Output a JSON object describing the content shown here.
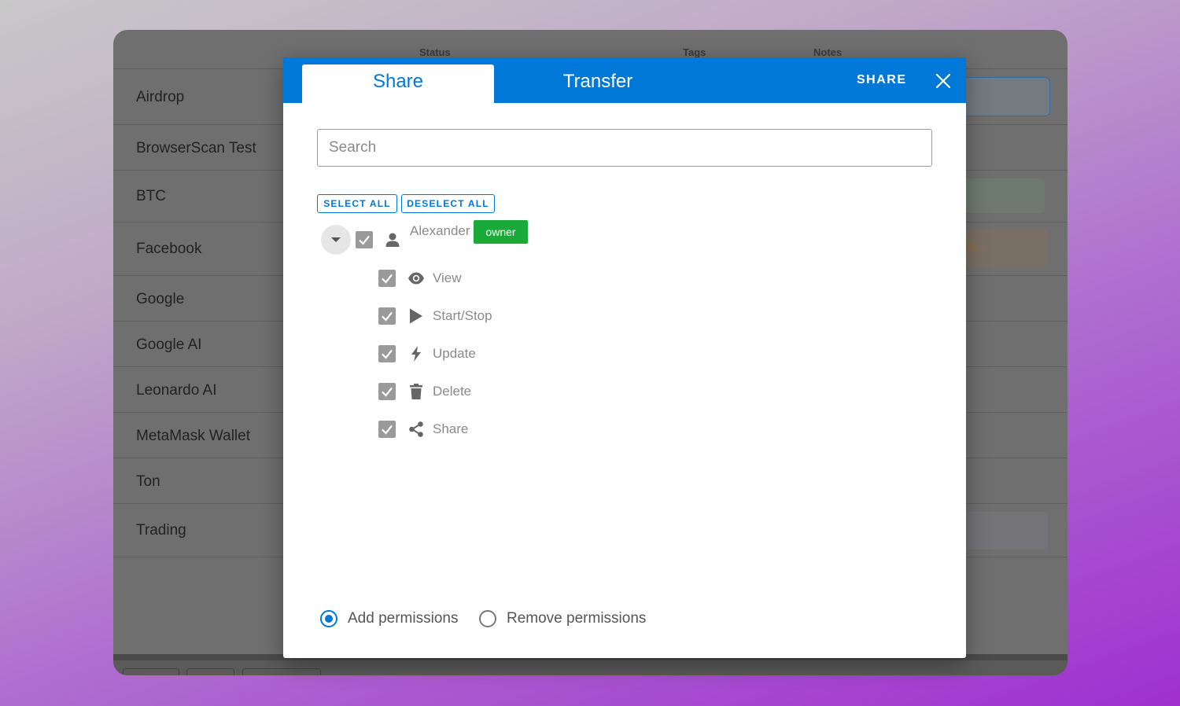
{
  "table": {
    "columns": [
      "Status",
      "Tags",
      "Notes"
    ],
    "rows": [
      "Airdrop",
      "BrowserScan Test",
      "BTC",
      "Facebook",
      "Google",
      "Google AI",
      "Leonardo AI",
      "MetaMask Wallet",
      "Ton",
      "Trading"
    ],
    "facebook_note_fragment": "gh..."
  },
  "modal": {
    "tabs": [
      "Share",
      "Transfer"
    ],
    "share_action": "SHARE",
    "close_icon": "close-icon",
    "search": {
      "placeholder": "Search",
      "value": ""
    },
    "select_all": "SELECT ALL",
    "deselect_all": "DESELECT ALL",
    "user": {
      "name": "Alexander",
      "badge": "owner",
      "checked": true
    },
    "permissions": [
      {
        "label": "View",
        "icon": "eye-icon",
        "checked": true
      },
      {
        "label": "Start/Stop",
        "icon": "play-icon",
        "checked": true
      },
      {
        "label": "Update",
        "icon": "bolt-icon",
        "checked": true
      },
      {
        "label": "Delete",
        "icon": "trash-icon",
        "checked": true
      },
      {
        "label": "Share",
        "icon": "share-icon",
        "checked": true
      }
    ],
    "mode_options": [
      {
        "label": "Add permissions",
        "selected": true
      },
      {
        "label": "Remove permissions",
        "selected": false
      }
    ]
  },
  "colors": {
    "accent": "#0078d7",
    "owner_badge": "#1aaa3a",
    "checkbox": "#9a9a9a"
  }
}
